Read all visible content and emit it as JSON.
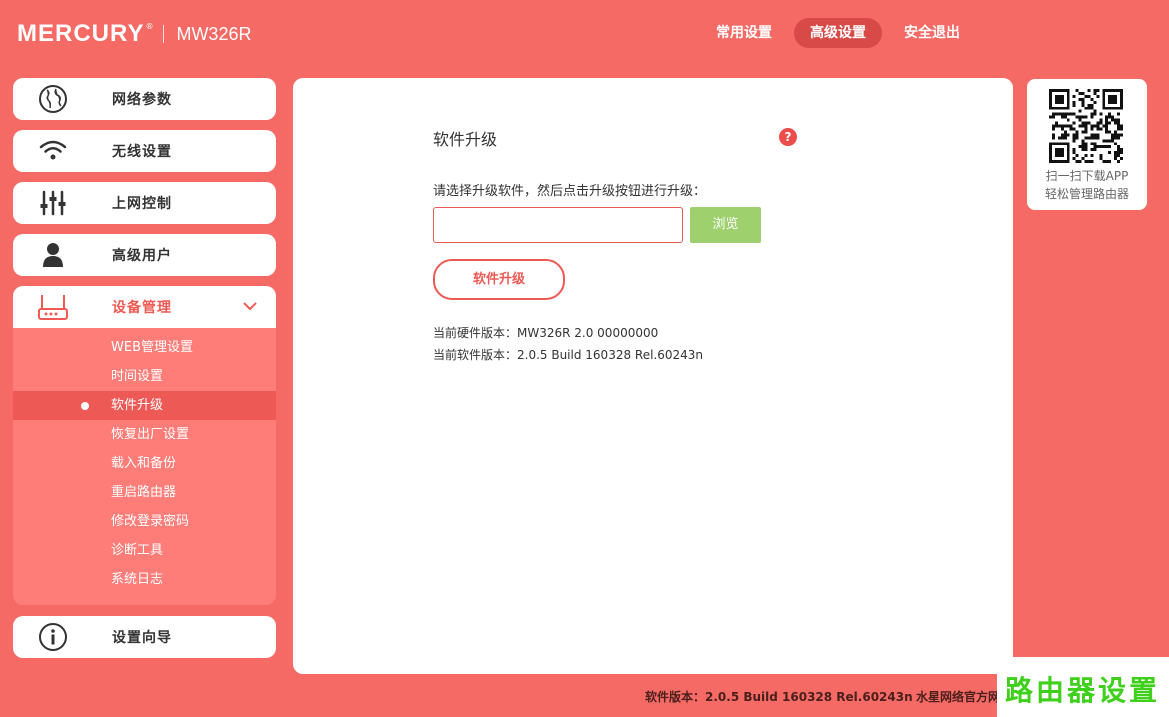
{
  "header": {
    "brand": "MERCURY",
    "registered": "®",
    "model": "MW326R",
    "nav": [
      "常用设置",
      "高级设置",
      "安全退出"
    ]
  },
  "sidebar": {
    "items": [
      {
        "label": "网络参数",
        "icon": "globe-icon"
      },
      {
        "label": "无线设置",
        "icon": "wifi-icon"
      },
      {
        "label": "上网控制",
        "icon": "sliders-icon"
      },
      {
        "label": "高级用户",
        "icon": "user-icon"
      },
      {
        "label": "设备管理",
        "icon": "router-icon"
      },
      {
        "label": "设置向导",
        "icon": "info-icon"
      }
    ],
    "submenu": [
      "WEB管理设置",
      "时间设置",
      "软件升级",
      "恢复出厂设置",
      "载入和备份",
      "重启路由器",
      "修改登录密码",
      "诊断工具",
      "系统日志"
    ],
    "active_submenu": "软件升级"
  },
  "main": {
    "title": "软件升级",
    "help": "?",
    "instruction": "请选择升级软件，然后点击升级按钮进行升级：",
    "file_value": "",
    "browse_label": "浏览",
    "upgrade_label": "软件升级",
    "hardware_version": "当前硬件版本：MW326R 2.0 00000000",
    "software_version": "当前软件版本：2.0.5 Build 160328 Rel.60243n"
  },
  "qr": {
    "line1": "扫一扫下载APP",
    "line2": "轻松管理路由器"
  },
  "footer": {
    "software": "软件版本：2.0.5 Build 160328 Rel.60243n",
    "site": "水星网络官方网"
  },
  "watermark": "路由器设置",
  "colors": {
    "background": "#f56a65",
    "accent": "#ec5a55",
    "active_nav": "#d84a48",
    "browse_button": "#9ed06e",
    "watermark": "#3fd01c"
  }
}
